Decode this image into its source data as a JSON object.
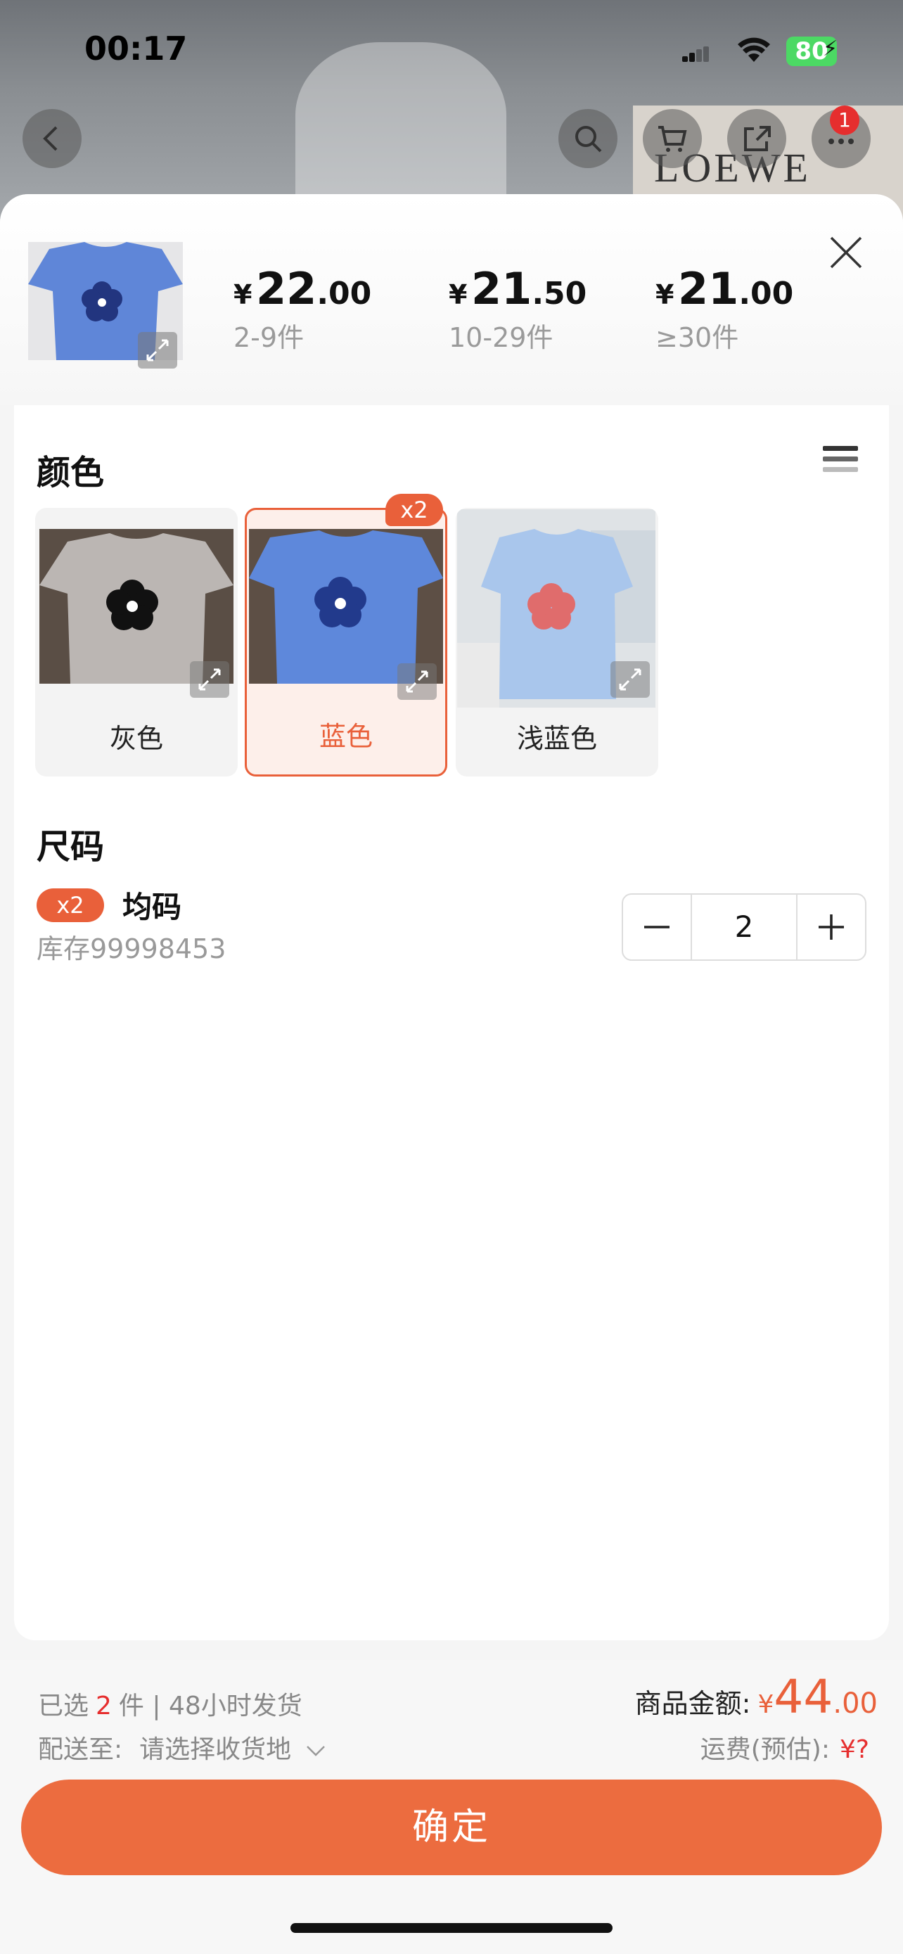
{
  "status_bar": {
    "time": "00:17",
    "battery": "80"
  },
  "top_nav": {
    "cart_badge": "1",
    "background_text": "LOEWE"
  },
  "price_tiers": [
    {
      "currency": "¥",
      "int": "22",
      "dec": ".00",
      "range": "2-9件"
    },
    {
      "currency": "¥",
      "int": "21",
      "dec": ".50",
      "range": "10-29件"
    },
    {
      "currency": "¥",
      "int": "21",
      "dec": ".00",
      "range": "≥30件"
    }
  ],
  "color_section": {
    "title": "颜色",
    "options": [
      {
        "label": "灰色",
        "selected": false
      },
      {
        "label": "蓝色",
        "selected": true,
        "badge": "x2"
      },
      {
        "label": "浅蓝色",
        "selected": false
      }
    ]
  },
  "size_section": {
    "title": "尺码",
    "item": {
      "badge": "x2",
      "name": "均码",
      "stock": "库存99998453",
      "quantity": "2"
    }
  },
  "footer": {
    "selected_prefix": "已选",
    "selected_count": "2",
    "selected_suffix": "件 | 48小时发货",
    "ship_label": "配送至:",
    "ship_value": "请选择收货地",
    "total_label": "商品金额:",
    "total_currency": "¥",
    "total_int": "44",
    "total_dec": ".00",
    "freight_label": "运费(预估):",
    "freight_value": "¥?",
    "confirm_label": "确定"
  },
  "colors": {
    "accent": "#e9603a",
    "button": "#ec6c3f",
    "badge_red": "#e62e2e"
  }
}
